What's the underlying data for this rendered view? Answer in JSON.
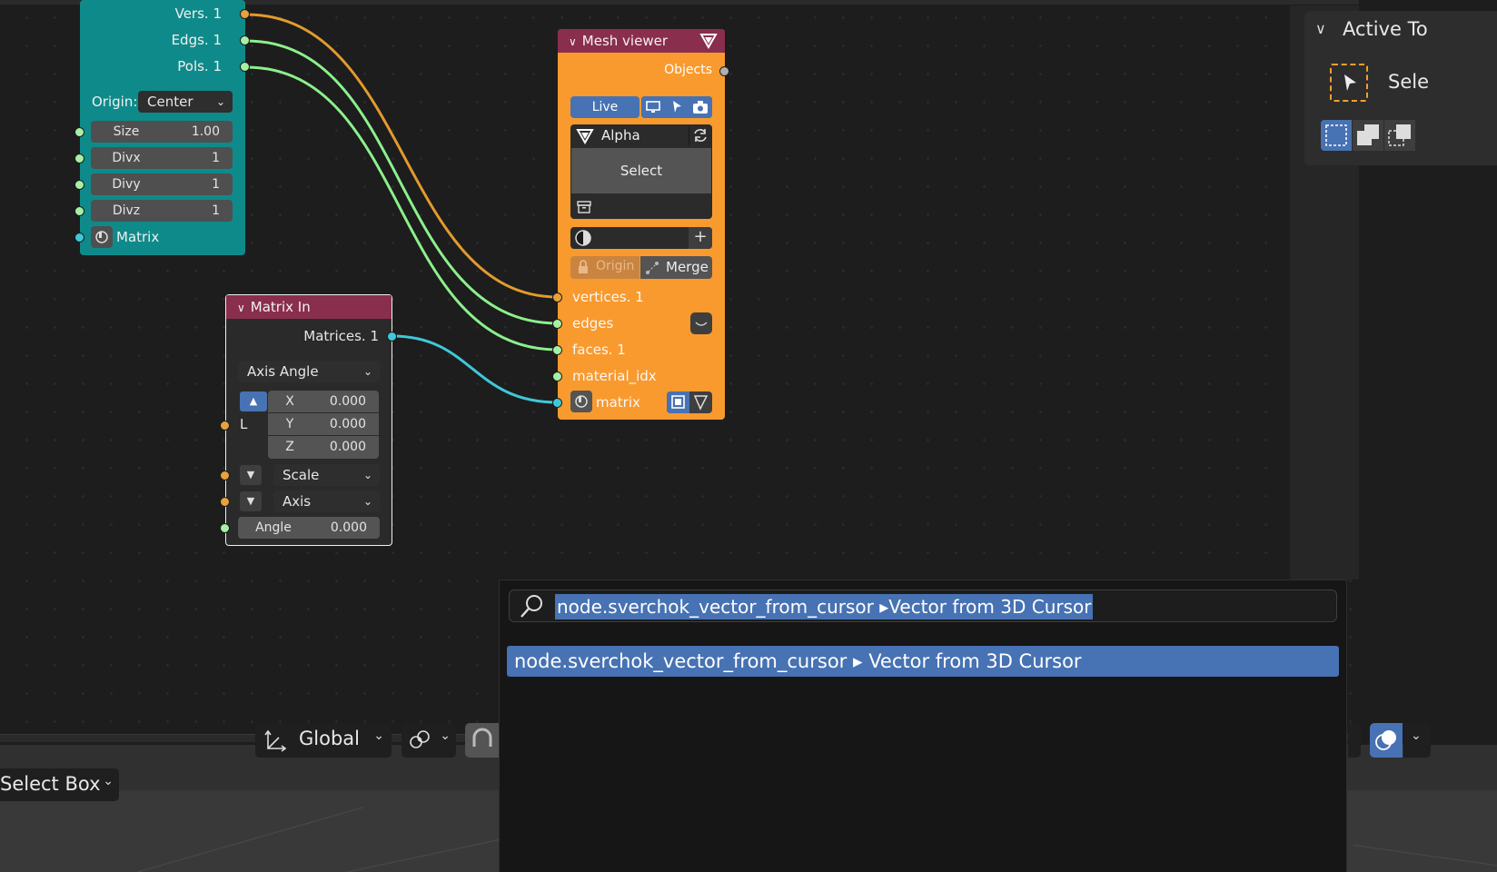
{
  "plane_node": {
    "outputs": [
      "Vers. 1",
      "Edgs. 1",
      "Pols. 1"
    ],
    "origin_label": "Origin:",
    "origin_value": "Center",
    "fields": [
      {
        "label": "Size",
        "value": "1.00"
      },
      {
        "label": "Divx",
        "value": "1"
      },
      {
        "label": "Divy",
        "value": "1"
      },
      {
        "label": "Divz",
        "value": "1"
      }
    ],
    "matrix_label": "Matrix"
  },
  "matrix_in_node": {
    "title": "Matrix In",
    "output": "Matrices. 1",
    "mode": "Axis Angle",
    "location_label": "L",
    "vector": [
      {
        "label": "X",
        "value": "0.000"
      },
      {
        "label": "Y",
        "value": "0.000"
      },
      {
        "label": "Z",
        "value": "0.000"
      }
    ],
    "scale_label": "Scale",
    "axis_label": "Axis",
    "angle_label": "Angle",
    "angle_value": "0.000"
  },
  "mesh_viewer_node": {
    "title": "Mesh viewer",
    "objects_label": "Objects",
    "live_label": "Live",
    "object_name": "Alpha",
    "select_label": "Select",
    "origin_label": "Origin",
    "merge_label": "Merge",
    "inputs": [
      "vertices. 1",
      "edges",
      "faces. 1",
      "material_idx",
      "matrix"
    ]
  },
  "right_panel": {
    "title": "Active To",
    "tool_label": "Sele"
  },
  "viewport_header": {
    "orientation": "Global",
    "select_mode": "Select Box"
  },
  "search_popup": {
    "query": "node.sverchok_vector_from_cursor ▸Vector from 3D Cursor",
    "result": "node.sverchok_vector_from_cursor ▸ Vector from 3D Cursor"
  },
  "colors": {
    "accent": "#4772b3",
    "plane_node": "#0f8a8a",
    "viewer_node": "#f99a2e",
    "node_header": "#8a2e4d"
  }
}
